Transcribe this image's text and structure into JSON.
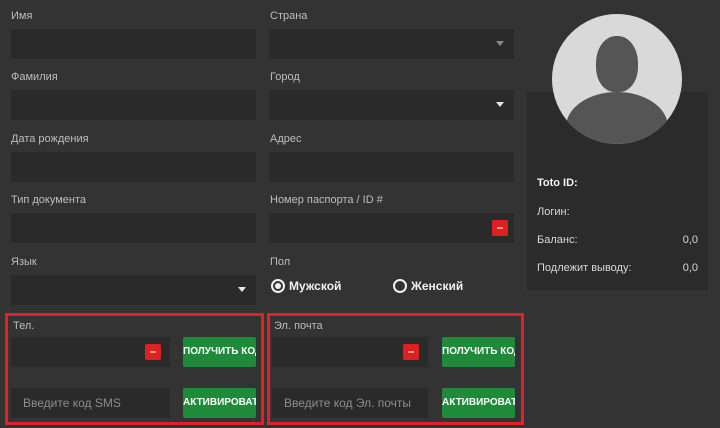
{
  "form": {
    "first_name_label": "Имя",
    "country_label": "Страна",
    "last_name_label": "Фамилия",
    "city_label": "Город",
    "dob_label": "Дата рождения",
    "address_label": "Адрес",
    "doc_type_label": "Тип документа",
    "passport_label": "Номер паспорта / ID #",
    "language_label": "Язык",
    "gender_label": "Пол",
    "gender_male": "Мужской",
    "gender_female": "Женский"
  },
  "phone": {
    "label": "Тел.",
    "get_code": "ПОЛУЧИТЬ КОД",
    "sms_placeholder": "Введите код SMS",
    "activate": "АКТИВИРОВАТЬ"
  },
  "email": {
    "label": "Эл. почта",
    "get_code": "ПОЛУЧИТЬ КОД",
    "code_placeholder": "Введите код Эл. почты",
    "activate": "АКТИВИРОВАТЬ"
  },
  "profile": {
    "toto_id_label": "Toto ID:",
    "login_label": "Логин:",
    "balance_label": "Баланс:",
    "balance_value": "0,0",
    "withdraw_label": "Подлежит выводу:",
    "withdraw_value": "0,0"
  },
  "colors": {
    "background": "#333333",
    "field": "#2a2a2a",
    "accent_green": "#1f8a3a",
    "highlight_red": "#e0202a"
  }
}
